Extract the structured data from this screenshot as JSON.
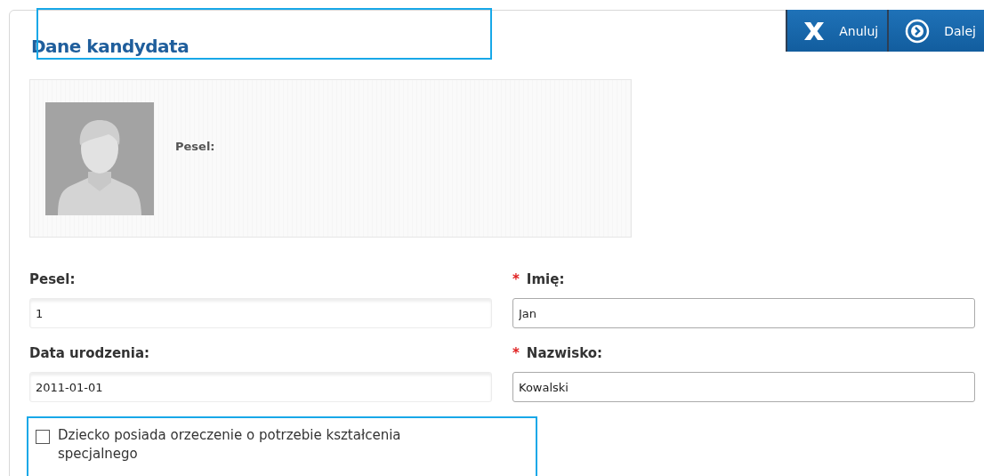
{
  "actions": [
    {
      "kind": "cancel",
      "label": "Anuluj"
    },
    {
      "kind": "next",
      "label": "Dalej"
    }
  ],
  "title": "Dane kandydata",
  "profile": {
    "kind": "picture",
    "pesel_label": "Pesel:"
  },
  "fields": [
    {
      "label": "Pesel:",
      "value": "1",
      "disabled": true
    },
    {
      "required_mark": "*",
      "label": "Imię:",
      "value": "Jan",
      "disabled": false
    },
    {
      "label": "Data urodzenia:",
      "value": "2011-01-01",
      "disabled": true
    },
    {
      "required_mark": "*",
      "label": "Nazwisko:",
      "value": "Kowalski",
      "disabled": false
    }
  ],
  "checkbox": {
    "label": "Dziecko posiada orzeczenie o potrzebie kształcenia specjalnego",
    "checked": false
  }
}
